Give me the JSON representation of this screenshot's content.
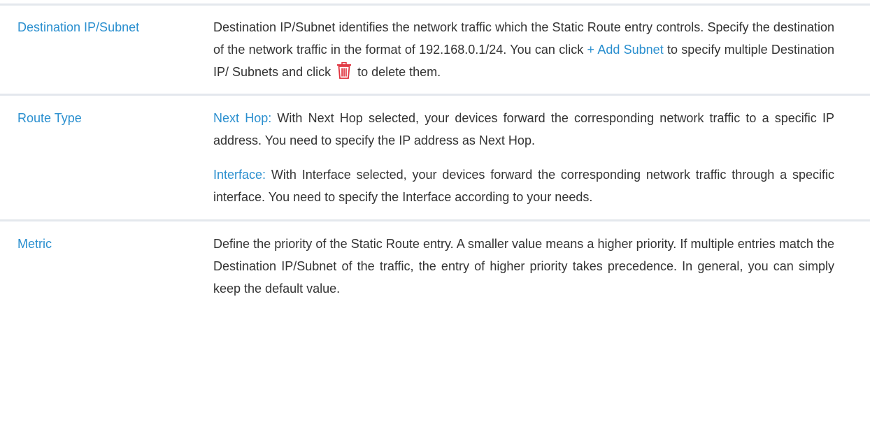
{
  "rows": [
    {
      "term": "Destination IP/Subnet",
      "desc": {
        "part1": "Destination IP/Subnet identifies the network traffic which the Static Route entry controls. Specify the destination of the network traffic in the format of 192.168.0.1/24.  You can click ",
        "link": "+ Add Subnet",
        "part2": " to specify multiple Destination IP/ Subnets and click ",
        "icon": "trash-icon",
        "part3": " to delete them."
      }
    },
    {
      "term": "Route Type",
      "paras": [
        {
          "label": "Next Hop:",
          "text": " With Next Hop selected, your devices forward the corresponding network traffic to a specific IP address. You need to specify the IP address as Next Hop."
        },
        {
          "label": "Interface:",
          "text": " With Interface selected, your devices forward the corresponding network traffic through a specific interface. You need to specify the Interface according to your needs."
        }
      ]
    },
    {
      "term": "Metric",
      "text": "Define the priority of the Static Route entry. A smaller value means a higher priority. If multiple entries match the Destination IP/Subnet of the traffic, the entry of higher priority takes precedence. In general, you can simply keep the default value."
    }
  ],
  "colors": {
    "accent": "#2a8fcf",
    "trash_icon": "#e0343f",
    "divider": "#e4e8ed"
  }
}
